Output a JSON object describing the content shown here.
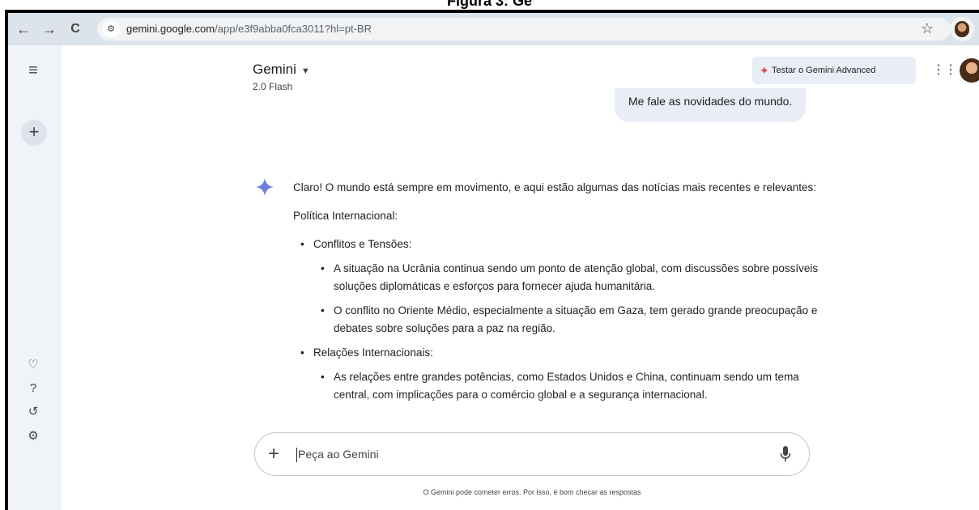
{
  "figure_caption": "Figura 3: Ge",
  "browser": {
    "url_host": "gemini.google.com",
    "url_rest": "/app/e3f9abba0fca3011?hl=pt-BR"
  },
  "header": {
    "model_name": "Gemini",
    "model_version": "2.0 Flash",
    "advanced_button": "Testar o Gemini Advanced"
  },
  "conversation": {
    "user_message": "Me fale as novidades do mundo.",
    "response_intro": "Claro! O mundo está sempre em movimento, e aqui estão algumas das notícias mais recentes e relevantes:",
    "section_title": "Política Internacional:",
    "topics": [
      {
        "title": "Conflitos e Tensões:",
        "items": [
          "A situação na Ucrânia continua sendo um ponto de atenção global, com discussões sobre possíveis soluções diplomáticas e esforços para fornecer ajuda humanitária.",
          "O conflito no Oriente Médio, especialmente a situação em Gaza, tem gerado grande preocupação e debates sobre soluções para a paz na região."
        ]
      },
      {
        "title": "Relações Internacionais:",
        "items": [
          "As relações entre grandes potências, como Estados Unidos e China, continuam sendo um tema central, com implicações para o comércio global e a segurança internacional."
        ]
      }
    ]
  },
  "input": {
    "placeholder": "Peça ao Gemini"
  },
  "footer": {
    "disclaimer": "O Gemini pode cometer erros. Por isso, é bom checar as respostas"
  },
  "icons": {
    "back": "back-arrow-icon",
    "forward": "forward-arrow-icon",
    "reload": "reload-icon",
    "site_settings": "site-settings-icon",
    "bookmark": "star-icon",
    "menu": "hamburger-menu-icon",
    "new_chat": "plus-icon",
    "gems": "gem-icon",
    "help": "help-icon",
    "activity": "history-icon",
    "settings": "settings-icon",
    "apps": "apps-grid-icon",
    "mic": "mic-icon"
  },
  "colors": {
    "sidebar_bg": "#f0f4f9",
    "bubble_bg": "#e9eef6",
    "spark_accent": "#e8453c",
    "gemini_blue": "#4285f4"
  }
}
